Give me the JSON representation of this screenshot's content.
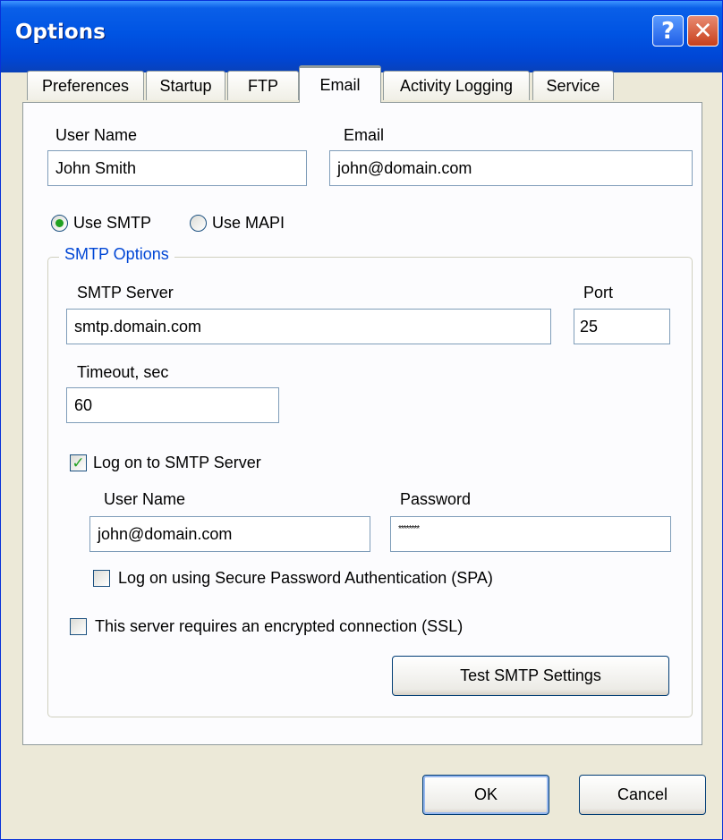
{
  "window": {
    "title": "Options"
  },
  "tabs": [
    {
      "label": "Preferences"
    },
    {
      "label": "Startup"
    },
    {
      "label": "FTP"
    },
    {
      "label": "Email"
    },
    {
      "label": "Activity Logging"
    },
    {
      "label": "Service"
    }
  ],
  "active_tab": "Email",
  "email": {
    "user_name_label": "User Name",
    "user_name_value": "John Smith",
    "email_label": "Email",
    "email_value": "john@domain.com",
    "use_smtp_label": "Use SMTP",
    "use_smtp_selected": true,
    "use_mapi_label": "Use MAPI"
  },
  "smtp": {
    "group_label": "SMTP Options",
    "server_label": "SMTP Server",
    "server_value": "smtp.domain.com",
    "port_label": "Port",
    "port_value": "25",
    "timeout_label": "Timeout, sec",
    "timeout_value": "60",
    "logon_label": "Log on to SMTP Server",
    "logon_checked": true,
    "logon_user_label": "User Name",
    "logon_user_value": "john@domain.com",
    "password_label": "Password",
    "password_value": "********",
    "spa_label": "Log on using Secure Password Authentication (SPA)",
    "spa_checked": false,
    "ssl_label": "This server requires an encrypted connection (SSL)",
    "ssl_checked": false,
    "test_button": "Test SMTP Settings"
  },
  "footer": {
    "ok_button": "OK",
    "cancel_button": "Cancel"
  },
  "colors": {
    "titlebar": "#0054e3",
    "check_mark": "#21a121",
    "group_legend": "#0046d5",
    "active_tab_highlight": "#ffc83c"
  }
}
